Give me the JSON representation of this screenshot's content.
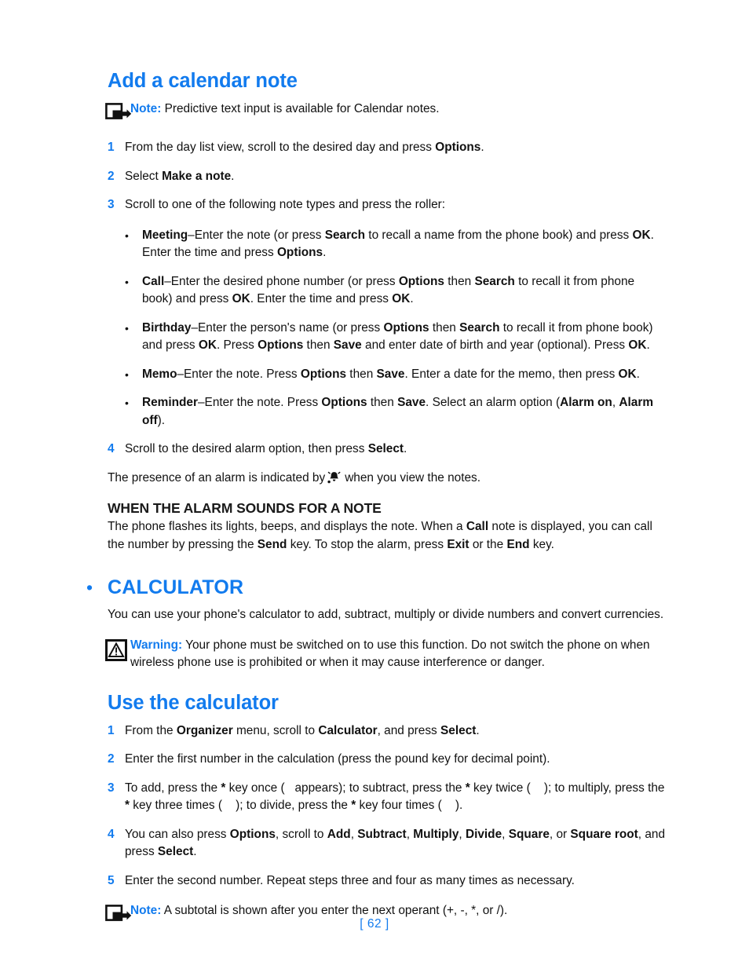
{
  "page": {
    "number_label": "[ 62 ]",
    "accent_color": "#127BEE",
    "text_color": "#111111"
  },
  "section_calendar": {
    "title": "Add a calendar note",
    "note": {
      "icon": "note-arrow-icon",
      "label": "Note:",
      "text": " Predictive text input is available for Calendar notes."
    },
    "steps": [
      {
        "num": "1",
        "html": "From the day list view, scroll to the desired day and press <b>Options</b>."
      },
      {
        "num": "2",
        "html": "Select <b>Make a note</b>."
      },
      {
        "num": "3",
        "html": "Scroll to one of the following note types and press the roller:"
      }
    ],
    "note_types": [
      {
        "bullet": "•",
        "html": "<b>Meeting</b>–Enter the note (or press <b>Search</b> to recall a name from the phone book) and press <b>OK</b>. Enter the time and press <b>Options</b>."
      },
      {
        "bullet": "•",
        "html": "<b>Call</b>–Enter the desired phone number (or press <b>Options</b> then <b>Search</b> to recall it from phone book) and press <b>OK</b>. Enter the time and press <b>OK</b>."
      },
      {
        "bullet": "•",
        "html": "<b>Birthday</b>–Enter the person's name (or press <b>Options</b> then <b>Search</b> to recall it from phone book) and press <b>OK</b>. Press <b>Options</b> then <b>Save</b> and enter date of birth and year (optional). Press <b>OK</b>."
      },
      {
        "bullet": "•",
        "html": "<b>Memo</b>–Enter the note. Press <b>Options</b> then <b>Save</b>. Enter a date for the memo, then press <b>OK</b>."
      },
      {
        "bullet": "•",
        "html": "<b>Reminder</b>–Enter the note. Press <b>Options</b> then <b>Save</b>. Select an alarm option (<b>Alarm on</b>, <b>Alarm off</b>)."
      }
    ],
    "step4": {
      "num": "4",
      "html": "Scroll to the desired alarm option, then press <b>Select</b>."
    },
    "alarm_presence": {
      "before": "The presence of an alarm is indicated by",
      "icon": "alarm-bell-icon",
      "after": "when you view the notes."
    },
    "alarm_sounds": {
      "heading": "WHEN THE ALARM SOUNDS FOR A NOTE",
      "html": "The phone flashes its lights, beeps, and displays the note. When a <b>Call</b> note is displayed, you can call the number by pressing the <b>Send</b> key. To stop the alarm, press <b>Exit</b> or the <b>End</b> key."
    }
  },
  "section_calculator": {
    "bullet": "•",
    "title": "CALCULATOR",
    "intro": "You can use your phone's calculator to add, subtract, multiply or divide numbers and convert currencies.",
    "warning": {
      "icon": "warning-triangle-icon",
      "label": "Warning:",
      "text": " Your phone must be switched on to use this function. Do not switch the phone on when wireless phone use is prohibited or when it may cause interference or danger."
    },
    "use_title": "Use the calculator",
    "steps": [
      {
        "num": "1",
        "html": "From the <b>Organizer</b> menu, scroll to <b>Calculator</b>, and press <b>Select</b>."
      },
      {
        "num": "2",
        "html": "Enter the first number in the calculation (press the pound key for decimal point)."
      },
      {
        "num": "3",
        "html": "To add, press the <b>*</b> key once (&nbsp;&nbsp; appears); to subtract, press the <b>*</b> key twice (&nbsp;&nbsp;&nbsp; ); to multiply, press the <b>*</b> key three times (&nbsp;&nbsp;&nbsp; ); to divide, press the <b>*</b> key four times (&nbsp;&nbsp;&nbsp; )."
      },
      {
        "num": "4",
        "html": "You can also press <b>Options</b>, scroll to <b>Add</b>, <b>Subtract</b>, <b>Multiply</b>, <b>Divide</b>, <b>Square</b>, or <b>Square root</b>, and press <b>Select</b>."
      },
      {
        "num": "5",
        "html": "Enter the second number. Repeat steps three and four as many times as necessary."
      }
    ],
    "note": {
      "icon": "note-arrow-icon",
      "label": "Note:",
      "text": " A subtotal is shown after you enter the next operant (+, -, *, or /)."
    }
  }
}
